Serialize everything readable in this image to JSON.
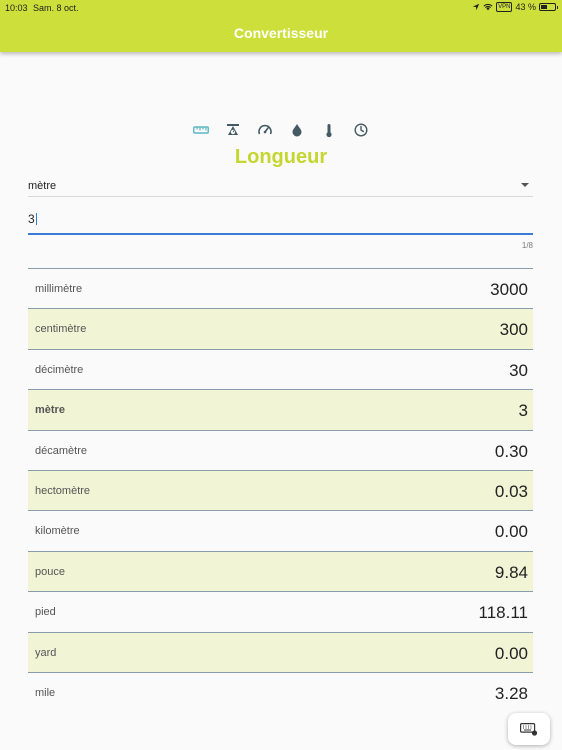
{
  "status_bar": {
    "time": "10:03",
    "date": "Sam. 8 oct.",
    "vpn": "VPN",
    "battery": "43 %",
    "battery_level": 0.43
  },
  "app": {
    "title": "Convertisseur"
  },
  "category_icons": [
    {
      "icon": "ruler-icon",
      "active": true
    },
    {
      "icon": "scale-icon",
      "active": false
    },
    {
      "icon": "speedometer-icon",
      "active": false
    },
    {
      "icon": "drop-icon",
      "active": false
    },
    {
      "icon": "thermometer-icon",
      "active": false
    },
    {
      "icon": "clock-icon",
      "active": false
    }
  ],
  "category": {
    "title": "Longueur"
  },
  "unit_select": {
    "value": "mètre"
  },
  "input": {
    "value": "3",
    "counter": "1/8"
  },
  "results": [
    {
      "unit": "millimètre",
      "value": "3000"
    },
    {
      "unit": "centimètre",
      "value": "300"
    },
    {
      "unit": "décimètre",
      "value": "30"
    },
    {
      "unit": "mètre",
      "value": "3",
      "selected": true
    },
    {
      "unit": "décamètre",
      "value": "0.30"
    },
    {
      "unit": "hectomètre",
      "value": "0.03"
    },
    {
      "unit": "kilomètre",
      "value": "0.00"
    },
    {
      "unit": "pouce",
      "value": "9.84"
    },
    {
      "unit": "pied",
      "value": "118.11"
    },
    {
      "unit": "yard",
      "value": "0.00"
    },
    {
      "unit": "mile",
      "value": "3.28"
    }
  ],
  "colors": {
    "accent": "#cddf3a",
    "title": "#c4d62f",
    "row_alt": "#f2f4d6",
    "input_line": "#3a7bd5"
  }
}
